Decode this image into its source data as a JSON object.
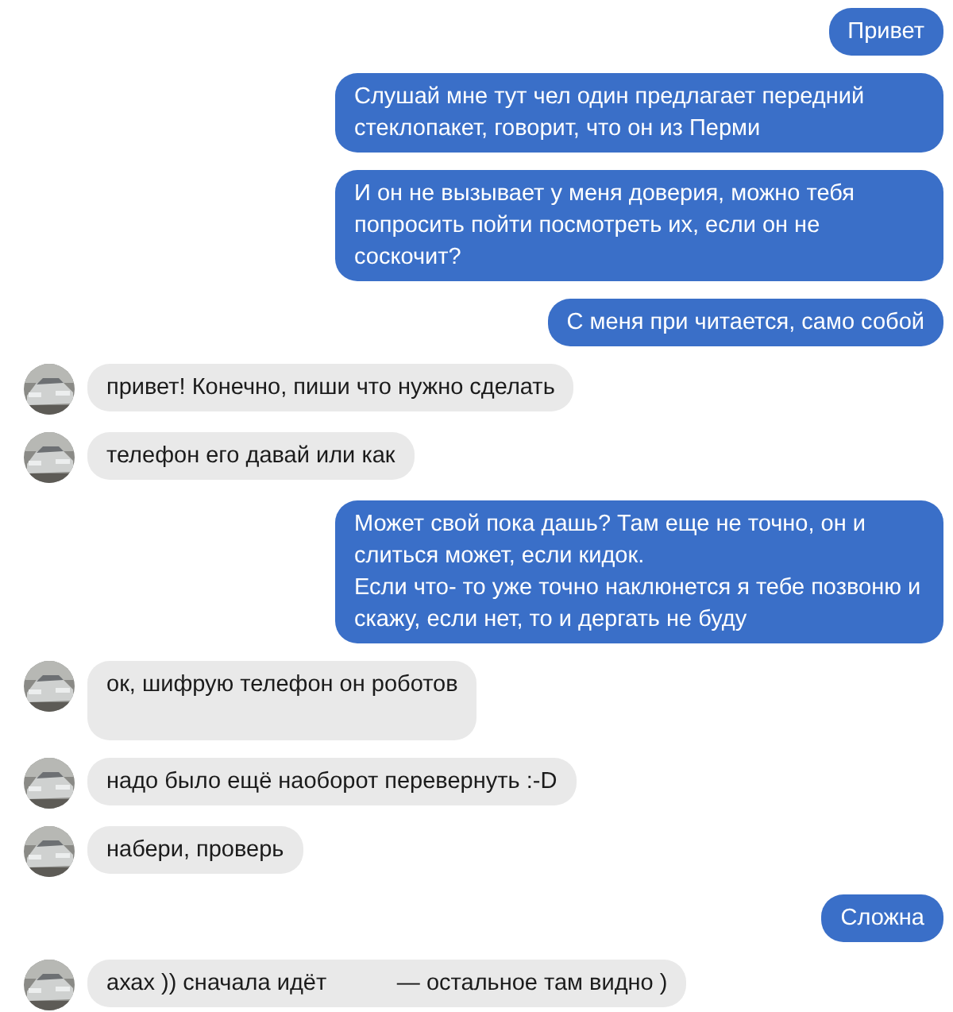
{
  "messages": [
    {
      "kind": "sent",
      "text": "Привет"
    },
    {
      "kind": "sent",
      "text": "Слушай мне тут чел один предлагает передний стеклопакет, говорит, что он из Перми"
    },
    {
      "kind": "sent",
      "text": "И он не вызывает у меня доверия, можно тебя попросить пойти посмотреть их, если он не соскочит?"
    },
    {
      "kind": "sent",
      "text": "С меня при читается, само собой"
    },
    {
      "kind": "received",
      "text": "привет! Конечно, пиши что нужно сделать"
    },
    {
      "kind": "received",
      "text": "телефон его давай или как"
    },
    {
      "kind": "sent",
      "text": "Может свой пока дашь? Там еще не точно, он и слиться может, если кидок.\nЕсли что- то уже точно наклюнется я тебе позвоню и скажу, если нет, то и дергать не буду"
    },
    {
      "kind": "received",
      "text": "ок, шифрую телефон он роботов\n "
    },
    {
      "kind": "received",
      "text": "надо было ещё наоборот перевернуть :-D"
    },
    {
      "kind": "received",
      "text": "набери, проверь"
    },
    {
      "kind": "sent",
      "text": "Сложна"
    },
    {
      "kind": "received",
      "text": "ахах )) сначала идёт           — остальное там видно )"
    }
  ]
}
